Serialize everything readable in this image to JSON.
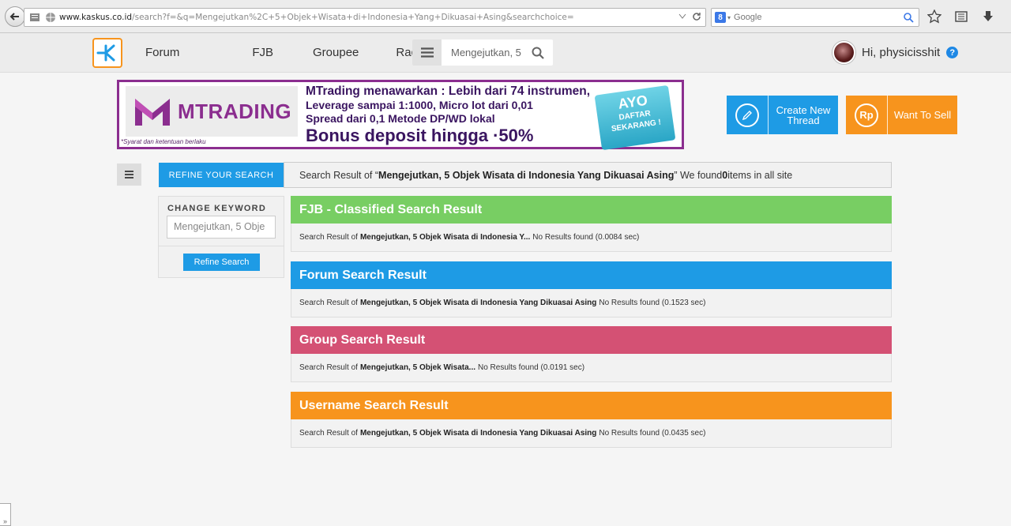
{
  "browser": {
    "url_domain": "www.kaskus.co.id",
    "url_path": "/search?f=&q=Mengejutkan%2C+5+Objek+Wisata+di+Indonesia+Yang+Dikuasai+Asing&searchchoice=",
    "search_engine_placeholder": "Google",
    "search_engine_badge": "8"
  },
  "header": {
    "nav": [
      "Forum",
      "FJB",
      "Groupee",
      "Radio"
    ],
    "search_value": "Mengejutkan, 5",
    "greeting": "Hi, physicisshit",
    "help_glyph": "?"
  },
  "banner": {
    "brand": "MTRADING",
    "line1": "MTrading menawarkan : Lebih dari 74 instrumen,",
    "line2": "Leverage sampai 1:1000, Micro lot dari 0,01",
    "line3": "Spread dari 0,1 Metode DP/WD lokal",
    "line4": "Bonus deposit hingga ·50%",
    "tag_big": "AYO",
    "tag_small1": "DAFTAR",
    "tag_small2": "SEKARANG !",
    "fine_print": "*Syarat dan ketentuan berlaku"
  },
  "actions": {
    "create_label": "Create New Thread",
    "sell_label": "Want To Sell",
    "sell_icon_text": "Rp"
  },
  "refine": {
    "tab_label": "REFINE YOUR SEARCH",
    "summary_prefix": "Search Result of “",
    "summary_query": "Mengejutkan, 5 Objek Wisata di Indonesia Yang Dikuasai Asing",
    "summary_mid": "” We found ",
    "summary_count": "0",
    "summary_suffix": " items in all site",
    "change_keyword_label": "CHANGE KEYWORD",
    "keyword_value": "Mengejutkan, 5 Obje",
    "refine_button": "Refine Search"
  },
  "results": {
    "prefix": "Search Result of",
    "fjb": {
      "title": "FJB - Classified Search Result",
      "query": "Mengejutkan, 5 Objek Wisata di Indonesia Y...",
      "status": " No Results found (0.0084 sec)"
    },
    "forum": {
      "title": "Forum Search Result",
      "query": "Mengejutkan, 5 Objek Wisata di Indonesia Yang Dikuasai Asing",
      "status": "No Results found (0.1523 sec)"
    },
    "group": {
      "title": "Group Search Result",
      "query": "Mengejutkan, 5 Objek Wisata...",
      "status": "No Results found (0.0191 sec)"
    },
    "username": {
      "title": "Username Search Result",
      "query": "Mengejutkan, 5 Objek Wisata di Indonesia Yang Dikuasai Asing",
      "status": "No Results found (0.0435 sec)"
    }
  },
  "corner_widget": "»",
  "colors": {
    "blue": "#1e9be5",
    "green": "#78ce63",
    "pink": "#d45174",
    "orange": "#f7941d",
    "purple": "#8b2e8f"
  }
}
